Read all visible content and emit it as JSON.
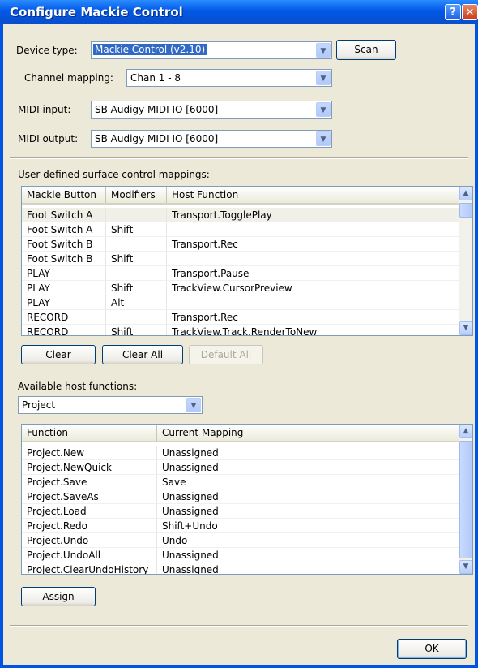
{
  "window": {
    "title": "Configure Mackie Control",
    "help_glyph": "?",
    "close_glyph": "✕"
  },
  "device_type": {
    "label": "Device type:",
    "value": "Mackie Control (v2.10)"
  },
  "scan_button": "Scan",
  "channel_mapping": {
    "label": "Channel mapping:",
    "value": "Chan 1 - 8"
  },
  "midi_input": {
    "label": "MIDI input:",
    "value": "SB Audigy MIDI IO [6000]"
  },
  "midi_output": {
    "label": "MIDI output:",
    "value": "SB Audigy MIDI IO [6000]"
  },
  "mappings": {
    "label": "User defined surface control mappings:",
    "columns": [
      "Mackie Button",
      "Modifiers",
      "Host Function"
    ],
    "rows": [
      [
        "Foot Switch A",
        "",
        "Transport.TogglePlay"
      ],
      [
        "Foot Switch A",
        "Shift",
        ""
      ],
      [
        "Foot Switch B",
        "",
        "Transport.Rec"
      ],
      [
        "Foot Switch B",
        "Shift",
        ""
      ],
      [
        "PLAY",
        "",
        "Transport.Pause"
      ],
      [
        "PLAY",
        "Shift",
        "TrackView.CursorPreview"
      ],
      [
        "PLAY",
        "Alt",
        ""
      ],
      [
        "RECORD",
        "",
        "Transport.Rec"
      ],
      [
        "RECORD",
        "Shift",
        "TrackView.Track.RenderToNew"
      ]
    ]
  },
  "buttons": {
    "clear": "Clear",
    "clear_all": "Clear All",
    "default_all": "Default All",
    "assign": "Assign",
    "ok": "OK"
  },
  "host_functions": {
    "label": "Available host functions:",
    "category": "Project",
    "columns": [
      "Function",
      "Current Mapping"
    ],
    "rows": [
      [
        "Project.New",
        "Unassigned"
      ],
      [
        "Project.NewQuick",
        "Unassigned"
      ],
      [
        "Project.Save",
        "Save"
      ],
      [
        "Project.SaveAs",
        "Unassigned"
      ],
      [
        "Project.Load",
        "Unassigned"
      ],
      [
        "Project.Redo",
        "Shift+Undo"
      ],
      [
        "Project.Undo",
        "Undo"
      ],
      [
        "Project.UndoAll",
        "Unassigned"
      ],
      [
        "Project.ClearUndoHistory",
        "Unassigned"
      ]
    ]
  },
  "icons": {
    "dropdown": "chevron-down-icon",
    "scroll_up": "arrow-up-icon",
    "scroll_down": "arrow-down-icon"
  }
}
